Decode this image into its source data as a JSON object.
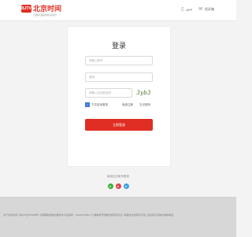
{
  "header": {
    "logo_mark": "BJTV",
    "logo_name": "北京时间",
    "slogan": "只做有温度的新闻资讯",
    "app_label": "APP",
    "comment_label": "投诉箱",
    "app_icon": "mobile-phone-icon",
    "comment_icon": "message-icon"
  },
  "login": {
    "title": "登录",
    "phone_placeholder": "请输入账号",
    "password_placeholder": "密码",
    "captcha_placeholder": "请输入右边验证码",
    "captcha_text": "3yb3",
    "remember_label": "下次自动登录",
    "register_link": "免费注册",
    "forgot_link": "忘记密码",
    "submit_label": "立即登录"
  },
  "third_party": {
    "label": "使用社交帐号登录",
    "providers": [
      {
        "name": "wechat",
        "icon": "wechat-icon",
        "color": "#3cb034"
      },
      {
        "name": "weibo",
        "icon": "weibo-icon",
        "color": "#e0434b"
      },
      {
        "name": "qq",
        "icon": "qq-icon",
        "color": "#3ba0e8"
      }
    ]
  },
  "footer": {
    "text": "关于北京时间 | 京ICP证150185号 | 互联网新闻信息服务许可证编号：11120170002 | 广播电视节目制作经营许可证 | 网络文化经营许可证 | 违法和不良信息举报电话"
  },
  "colors": {
    "brand": "#e02e24",
    "checkbox": "#3a7bd5"
  }
}
